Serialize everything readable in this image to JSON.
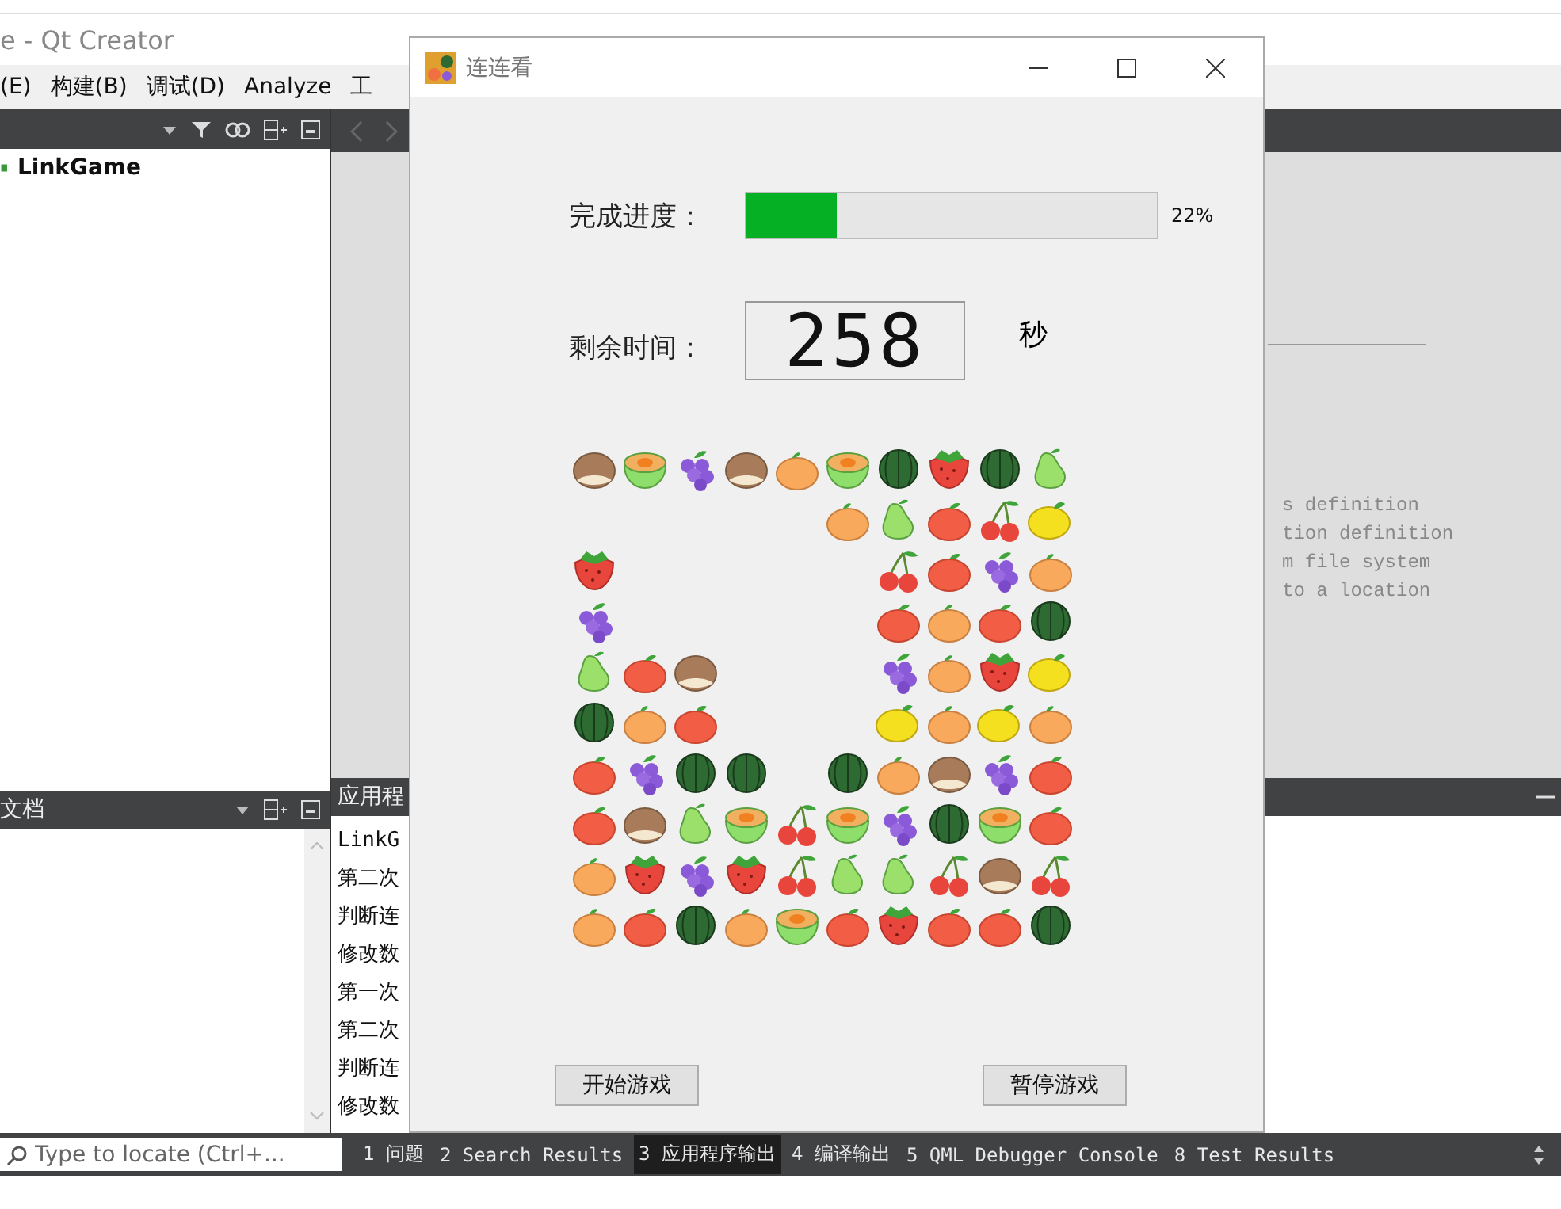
{
  "qt_creator": {
    "window_title": "e - Qt Creator",
    "menu": [
      "(E)",
      "构建(B)",
      "调试(D)",
      "Analyze",
      "工"
    ],
    "project_tree": [
      {
        "label": "LinkGame"
      }
    ],
    "editor_lines": [
      "s definition",
      "tion definition",
      "m file system",
      "to a location"
    ],
    "documents_header": "文档",
    "output_header": "应用程",
    "output_lines": [
      "LinkG",
      "第二次",
      "判断连",
      "修改数",
      "第一次",
      "第二次",
      "判断连",
      "修改数"
    ],
    "locator": {
      "placeholder": "Type to locate (Ctrl+..."
    },
    "output_tabs": [
      {
        "label": "1 问题",
        "selected": false
      },
      {
        "label": "2 Search Results",
        "selected": false
      },
      {
        "label": "3 应用程序输出",
        "selected": true
      },
      {
        "label": "4 编译输出",
        "selected": false
      },
      {
        "label": "5 QML Debugger Console",
        "selected": false
      },
      {
        "label": "8 Test Results",
        "selected": false
      }
    ]
  },
  "game_window": {
    "title": "连连看",
    "progress_label": "完成进度：",
    "progress": {
      "level": 0.22
    },
    "progress_reading": "22%",
    "time_label": "剩余时间：",
    "time_value": "258",
    "time_unit": "秒",
    "board": [
      [
        {
          "kind": "chestnut"
        },
        {
          "kind": "melon"
        },
        {
          "kind": "grape"
        },
        {
          "kind": "chestnut"
        },
        {
          "kind": "orange"
        },
        {
          "kind": "melon"
        },
        {
          "kind": "watermelon"
        },
        {
          "kind": "strawberry"
        },
        {
          "kind": "watermelon"
        },
        {
          "kind": "pear"
        }
      ],
      [
        {
          "kind": "empty"
        },
        {
          "kind": "empty"
        },
        {
          "kind": "empty"
        },
        {
          "kind": "empty"
        },
        {
          "kind": "empty"
        },
        {
          "kind": "orange"
        },
        {
          "kind": "pear"
        },
        {
          "kind": "apple"
        },
        {
          "kind": "cherry"
        },
        {
          "kind": "lemon"
        }
      ],
      [
        {
          "kind": "strawberry"
        },
        {
          "kind": "empty"
        },
        {
          "kind": "empty"
        },
        {
          "kind": "empty"
        },
        {
          "kind": "empty"
        },
        {
          "kind": "empty"
        },
        {
          "kind": "cherry"
        },
        {
          "kind": "apple"
        },
        {
          "kind": "grape"
        },
        {
          "kind": "orange"
        }
      ],
      [
        {
          "kind": "grape"
        },
        {
          "kind": "empty"
        },
        {
          "kind": "empty"
        },
        {
          "kind": "empty"
        },
        {
          "kind": "empty"
        },
        {
          "kind": "empty"
        },
        {
          "kind": "apple"
        },
        {
          "kind": "orange"
        },
        {
          "kind": "apple"
        },
        {
          "kind": "watermelon"
        }
      ],
      [
        {
          "kind": "pear"
        },
        {
          "kind": "apple"
        },
        {
          "kind": "chestnut"
        },
        {
          "kind": "empty"
        },
        {
          "kind": "empty"
        },
        {
          "kind": "empty"
        },
        {
          "kind": "grape"
        },
        {
          "kind": "orange"
        },
        {
          "kind": "strawberry"
        },
        {
          "kind": "lemon"
        }
      ],
      [
        {
          "kind": "watermelon"
        },
        {
          "kind": "orange"
        },
        {
          "kind": "apple"
        },
        {
          "kind": "empty"
        },
        {
          "kind": "empty"
        },
        {
          "kind": "empty"
        },
        {
          "kind": "lemon"
        },
        {
          "kind": "orange"
        },
        {
          "kind": "lemon"
        },
        {
          "kind": "orange"
        }
      ],
      [
        {
          "kind": "apple"
        },
        {
          "kind": "grape"
        },
        {
          "kind": "watermelon"
        },
        {
          "kind": "watermelon"
        },
        {
          "kind": "empty"
        },
        {
          "kind": "watermelon"
        },
        {
          "kind": "orange"
        },
        {
          "kind": "chestnut"
        },
        {
          "kind": "grape"
        },
        {
          "kind": "apple"
        }
      ],
      [
        {
          "kind": "apple"
        },
        {
          "kind": "chestnut"
        },
        {
          "kind": "pear"
        },
        {
          "kind": "melon"
        },
        {
          "kind": "cherry"
        },
        {
          "kind": "melon"
        },
        {
          "kind": "grape"
        },
        {
          "kind": "watermelon"
        },
        {
          "kind": "melon"
        },
        {
          "kind": "apple"
        }
      ],
      [
        {
          "kind": "orange"
        },
        {
          "kind": "strawberry"
        },
        {
          "kind": "grape"
        },
        {
          "kind": "strawberry"
        },
        {
          "kind": "cherry"
        },
        {
          "kind": "pear"
        },
        {
          "kind": "pear"
        },
        {
          "kind": "cherry"
        },
        {
          "kind": "chestnut"
        },
        {
          "kind": "cherry"
        }
      ],
      [
        {
          "kind": "orange"
        },
        {
          "kind": "apple"
        },
        {
          "kind": "watermelon"
        },
        {
          "kind": "orange"
        },
        {
          "kind": "melon"
        },
        {
          "kind": "apple"
        },
        {
          "kind": "strawberry"
        },
        {
          "kind": "apple"
        },
        {
          "kind": "apple"
        },
        {
          "kind": "watermelon"
        }
      ]
    ],
    "buttons": [
      "开始游戏",
      "暂停游戏"
    ]
  }
}
